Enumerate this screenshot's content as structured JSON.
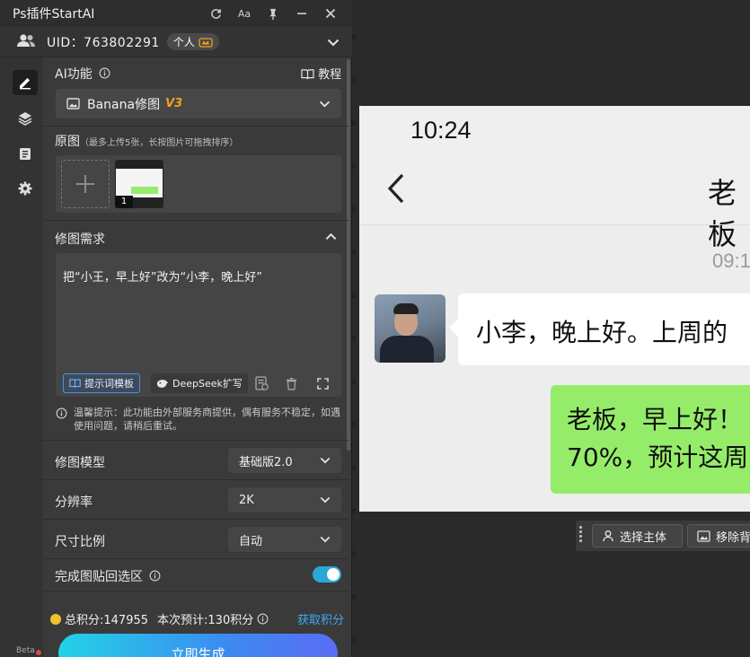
{
  "plugin": {
    "title": "Ps插件StartAI",
    "user": {
      "uid_text": "UID：763802291",
      "badge": "个人"
    },
    "ai_function": {
      "label": "AI功能",
      "tutorial": "教程"
    },
    "model_select": {
      "label": "Banana修图",
      "version": "V3"
    },
    "original": {
      "label": "原图",
      "hint": "（最多上传5张，长按图片可拖拽排序）",
      "thumb_index": "1"
    },
    "requirement": {
      "label": "修图需求",
      "text": "把“小王，早上好”改为“小李，晚上好”",
      "prompt_template_btn": "提示词模板",
      "deepseek_btn": "DeepSeek扩写"
    },
    "notice": "温馨提示：此功能由外部服务商提供，偶有服务不稳定，如遇使用问题，请稍后重试。",
    "model": {
      "label": "修图模型",
      "value": "基础版2.0"
    },
    "resolution": {
      "label": "分辨率",
      "value": "2K"
    },
    "ratio": {
      "label": "尺寸比例",
      "value": "自动"
    },
    "paste_back": {
      "label": "完成图贴回选区",
      "enabled": true
    },
    "points": {
      "total": "总积分:147955",
      "estimate": "本次预计:130积分",
      "get": "获取积分"
    },
    "generate_btn": "立即生成",
    "beta": "Beta",
    "colors": {
      "accent": "#3fa9f5",
      "version": "#f0a020",
      "toggle": "#2aa8d8"
    }
  },
  "canvas": {
    "time": "10:24",
    "chat_title": "老板",
    "timestamp": "09:1",
    "incoming": "小李，晚上好。上周的",
    "outgoing_line1": "老板，早上好！",
    "outgoing_line2": "70%，预计这周"
  },
  "selection_bar": {
    "select_subject": "选择主体",
    "remove_bg": "移除背"
  }
}
